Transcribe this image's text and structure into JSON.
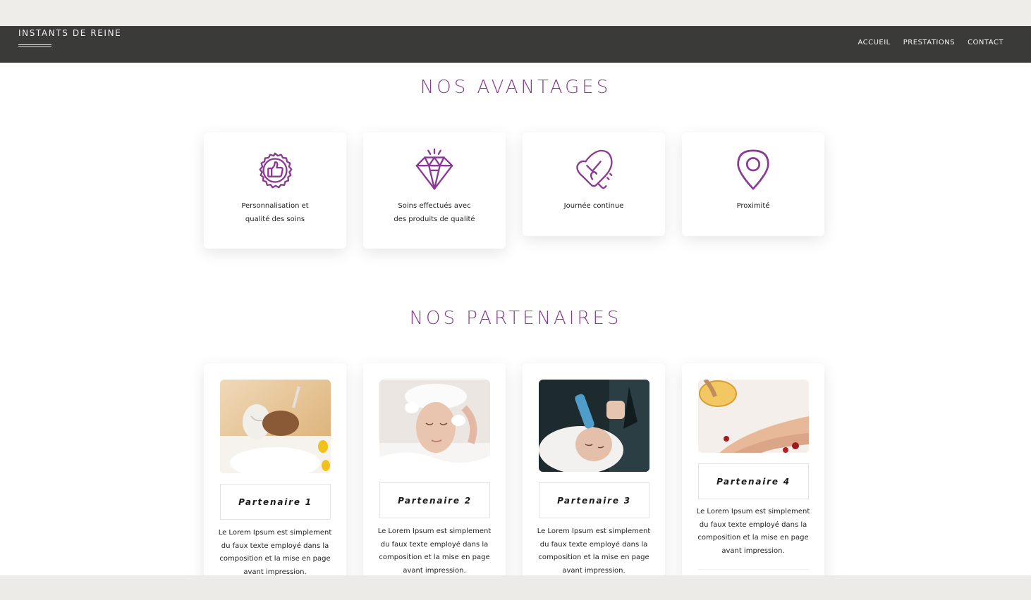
{
  "header": {
    "brand": "INSTANTS DE REINE",
    "nav": [
      "ACCUEIL",
      "PRESTATIONS",
      "CONTACT"
    ]
  },
  "advantages": {
    "title": "NOS AVANTAGES",
    "items": [
      {
        "icon": "thumbs-up-badge-icon",
        "line1": "Personnalisation et",
        "line2": "qualité des soins"
      },
      {
        "icon": "diamond-icon",
        "line1": "Soins effectués avec",
        "line2": "des produits de qualité"
      },
      {
        "icon": "heart-check-icon",
        "line1": "Journée continue",
        "line2": ""
      },
      {
        "icon": "map-pin-icon",
        "line1": "Proximité",
        "line2": ""
      }
    ]
  },
  "partners": {
    "title": "NOS PARTENAIRES",
    "items": [
      {
        "name": "Partenaire 1",
        "lines": [
          "Le Lorem Ipsum est simplement",
          "du faux texte employé dans la",
          "composition et la mise en page",
          "avant impression."
        ]
      },
      {
        "name": "Partenaire 2",
        "lines": [
          "Le Lorem Ipsum est simplement",
          "du faux texte employé dans la",
          "composition et la mise en page",
          "avant impression."
        ]
      },
      {
        "name": "Partenaire 3",
        "lines": [
          "Le Lorem Ipsum est simplement",
          "du faux texte employé dans la",
          "composition et la mise en page",
          "avant impression."
        ]
      },
      {
        "name": "Partenaire 4",
        "lines": [
          "Le Lorem Ipsum est simplement",
          "du faux texte employé dans la",
          "composition et la mise en page",
          "avant impression."
        ]
      }
    ]
  },
  "colors": {
    "accent": "#8b3a93",
    "navbar": "#3a3a38",
    "background": "#ecebe7"
  }
}
